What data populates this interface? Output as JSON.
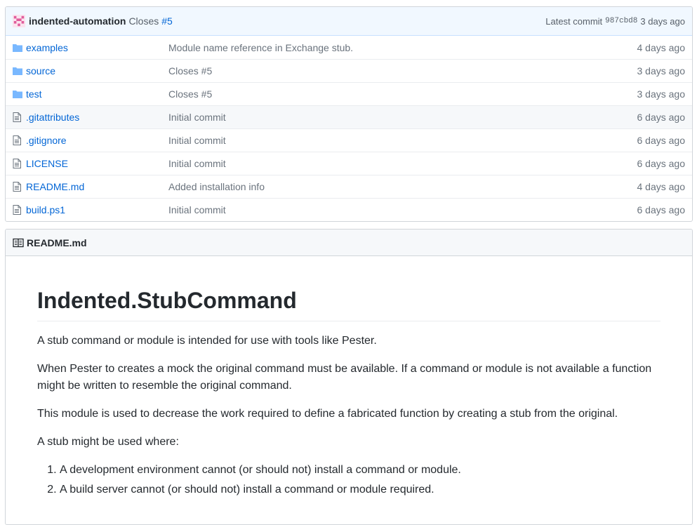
{
  "commit": {
    "author": "indented-automation",
    "message": "Closes",
    "issue": "#5",
    "latest_label": "Latest commit",
    "sha": "987cbd8",
    "age": "3 days ago"
  },
  "files": [
    {
      "type": "folder",
      "name": "examples",
      "message": "Module name reference in Exchange stub.",
      "age": "4 days ago"
    },
    {
      "type": "folder",
      "name": "source",
      "message": "Closes #5",
      "age": "3 days ago"
    },
    {
      "type": "folder",
      "name": "test",
      "message": "Closes #5",
      "age": "3 days ago"
    },
    {
      "type": "file",
      "name": ".gitattributes",
      "message": "Initial commit",
      "age": "6 days ago"
    },
    {
      "type": "file",
      "name": ".gitignore",
      "message": "Initial commit",
      "age": "6 days ago"
    },
    {
      "type": "file",
      "name": "LICENSE",
      "message": "Initial commit",
      "age": "6 days ago"
    },
    {
      "type": "file",
      "name": "README.md",
      "message": "Added installation info",
      "age": "4 days ago"
    },
    {
      "type": "file",
      "name": "build.ps1",
      "message": "Initial commit",
      "age": "6 days ago"
    }
  ],
  "readme": {
    "filename": "README.md",
    "title": "Indented.StubCommand",
    "paragraphs": [
      "A stub command or module is intended for use with tools like Pester.",
      "When Pester to creates a mock the original command must be available. If a command or module is not available a function might be written to resemble the original command.",
      "This module is used to decrease the work required to define a fabricated function by creating a stub from the original.",
      "A stub might be used where:"
    ],
    "list": [
      "A development environment cannot (or should not) install a command or module.",
      "A build server cannot (or should not) install a command or module required."
    ]
  },
  "colors": {
    "link": "#0366d6",
    "folder_icon": "#79b8ff",
    "commit_bar_bg": "#f1f8ff"
  }
}
